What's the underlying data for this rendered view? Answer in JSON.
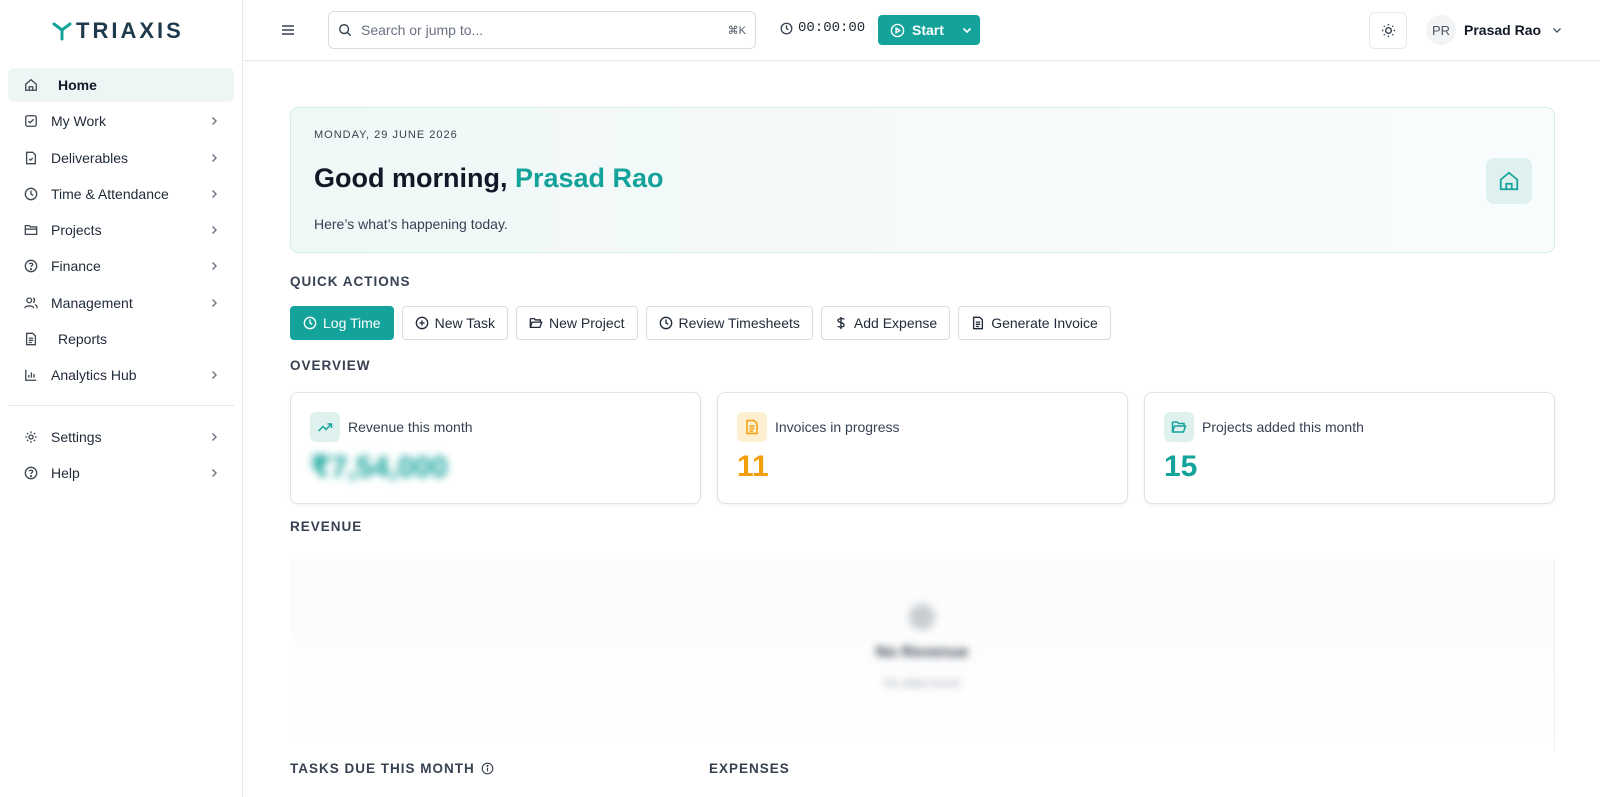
{
  "brand": {
    "name": "TRIAXIS",
    "accent": "#14a39a"
  },
  "sidebar": {
    "items": [
      {
        "label": "Home",
        "icon": "home-icon"
      },
      {
        "label": "My Work",
        "icon": "checkbox-icon"
      },
      {
        "label": "Deliverables",
        "icon": "file-check-icon"
      },
      {
        "label": "Time & Attendance",
        "icon": "clock-icon"
      },
      {
        "label": "Projects",
        "icon": "folder-icon"
      },
      {
        "label": "Finance",
        "icon": "finance-icon"
      },
      {
        "label": "Management",
        "icon": "users-icon"
      },
      {
        "label": "Reports",
        "icon": "file-text-icon"
      },
      {
        "label": "Analytics Hub",
        "icon": "bar-chart-icon"
      }
    ],
    "footer": [
      {
        "label": "Settings",
        "icon": "gear-icon"
      },
      {
        "label": "Help",
        "icon": "help-icon"
      }
    ]
  },
  "topbar": {
    "search_placeholder": "Search or jump to...",
    "search_shortcut": "⌘K",
    "timer": "00:00:00",
    "start_label": "Start",
    "user_initials": "PR",
    "user_name": "Prasad Rao"
  },
  "hero": {
    "date": "MONDAY, 29 JUNE 2026",
    "greeting": "Good morning, ",
    "name": "Prasad Rao",
    "subtitle": "Here’s what’s happening today."
  },
  "quick_actions": {
    "title": "QUICK ACTIONS",
    "items": [
      "Log Time",
      "New Task",
      "New Project",
      "Review Timesheets",
      "Add Expense",
      "Generate Invoice"
    ]
  },
  "overview": {
    "title": "OVERVIEW",
    "cards": [
      {
        "label": "Revenue this month",
        "value": "₹7,54,000",
        "color": "#14a39a"
      },
      {
        "label": "Invoices in progress",
        "value": "11",
        "color": "#f59e0b"
      },
      {
        "label": "Projects added this month",
        "value": "15",
        "color": "#14a39a"
      }
    ]
  },
  "revenue": {
    "title": "REVENUE",
    "empty_title": "No Revenue",
    "empty_sub": "No data found"
  },
  "bottom": {
    "tasks_title": "TASKS DUE THIS MONTH",
    "expenses_title": "EXPENSES"
  }
}
